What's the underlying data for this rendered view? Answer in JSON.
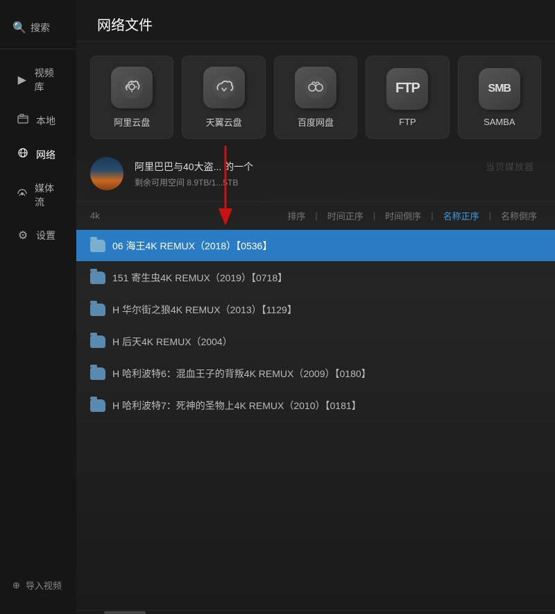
{
  "sidebar": {
    "search_label": "搜索",
    "items": [
      {
        "id": "video-library",
        "label": "视频库",
        "icon": "▶"
      },
      {
        "id": "local",
        "label": "本地",
        "icon": "📁"
      },
      {
        "id": "network",
        "label": "网络",
        "icon": "🌐"
      },
      {
        "id": "media-stream",
        "label": "媒体流",
        "icon": "☁"
      },
      {
        "id": "settings",
        "label": "设置",
        "icon": "⚙"
      }
    ],
    "import_label": "导入视频"
  },
  "header": {
    "title": "网络文件"
  },
  "services": [
    {
      "id": "aliyun",
      "label": "阿里云盘",
      "icon_type": "aliyun"
    },
    {
      "id": "tianyi",
      "label": "天翼云盘",
      "icon_type": "tianyi"
    },
    {
      "id": "baidu",
      "label": "百度网盘",
      "icon_type": "baidu"
    },
    {
      "id": "ftp",
      "label": "FTP",
      "icon_type": "ftp"
    },
    {
      "id": "samba",
      "label": "SAMBA",
      "icon_type": "samba"
    }
  ],
  "account": {
    "name": "阿里巴巴与40大盗... 的一个",
    "space": "剩余可用空间 8.9TB/1...5TB"
  },
  "sort_bar": {
    "label": "4k",
    "options": [
      {
        "id": "order",
        "label": "排序"
      },
      {
        "id": "time-asc",
        "label": "时间正序"
      },
      {
        "id": "time-desc",
        "label": "时间倒序"
      },
      {
        "id": "name-asc",
        "label": "名称正序",
        "active": true
      },
      {
        "id": "name-desc",
        "label": "名称倒序"
      }
    ]
  },
  "files": [
    {
      "id": 1,
      "name": "06 海王4K REMUX（2018）【0536】",
      "selected": true
    },
    {
      "id": 2,
      "name": "151 寄生虫4K REMUX（2019）【0718】",
      "selected": false
    },
    {
      "id": 3,
      "name": "H 华尔街之狼4K REMUX（2013）【1129】",
      "selected": false
    },
    {
      "id": 4,
      "name": "H 后天4K REMUX（2004）",
      "selected": false
    },
    {
      "id": 5,
      "name": "H 哈利波特6：混血王子的背叛4K REMUX（2009）【0180】",
      "selected": false
    },
    {
      "id": 6,
      "name": "H 哈利波特7：死神的圣物上4K REMUX（2010）【0181】",
      "selected": false
    }
  ],
  "watermark": "当贝媒放器"
}
